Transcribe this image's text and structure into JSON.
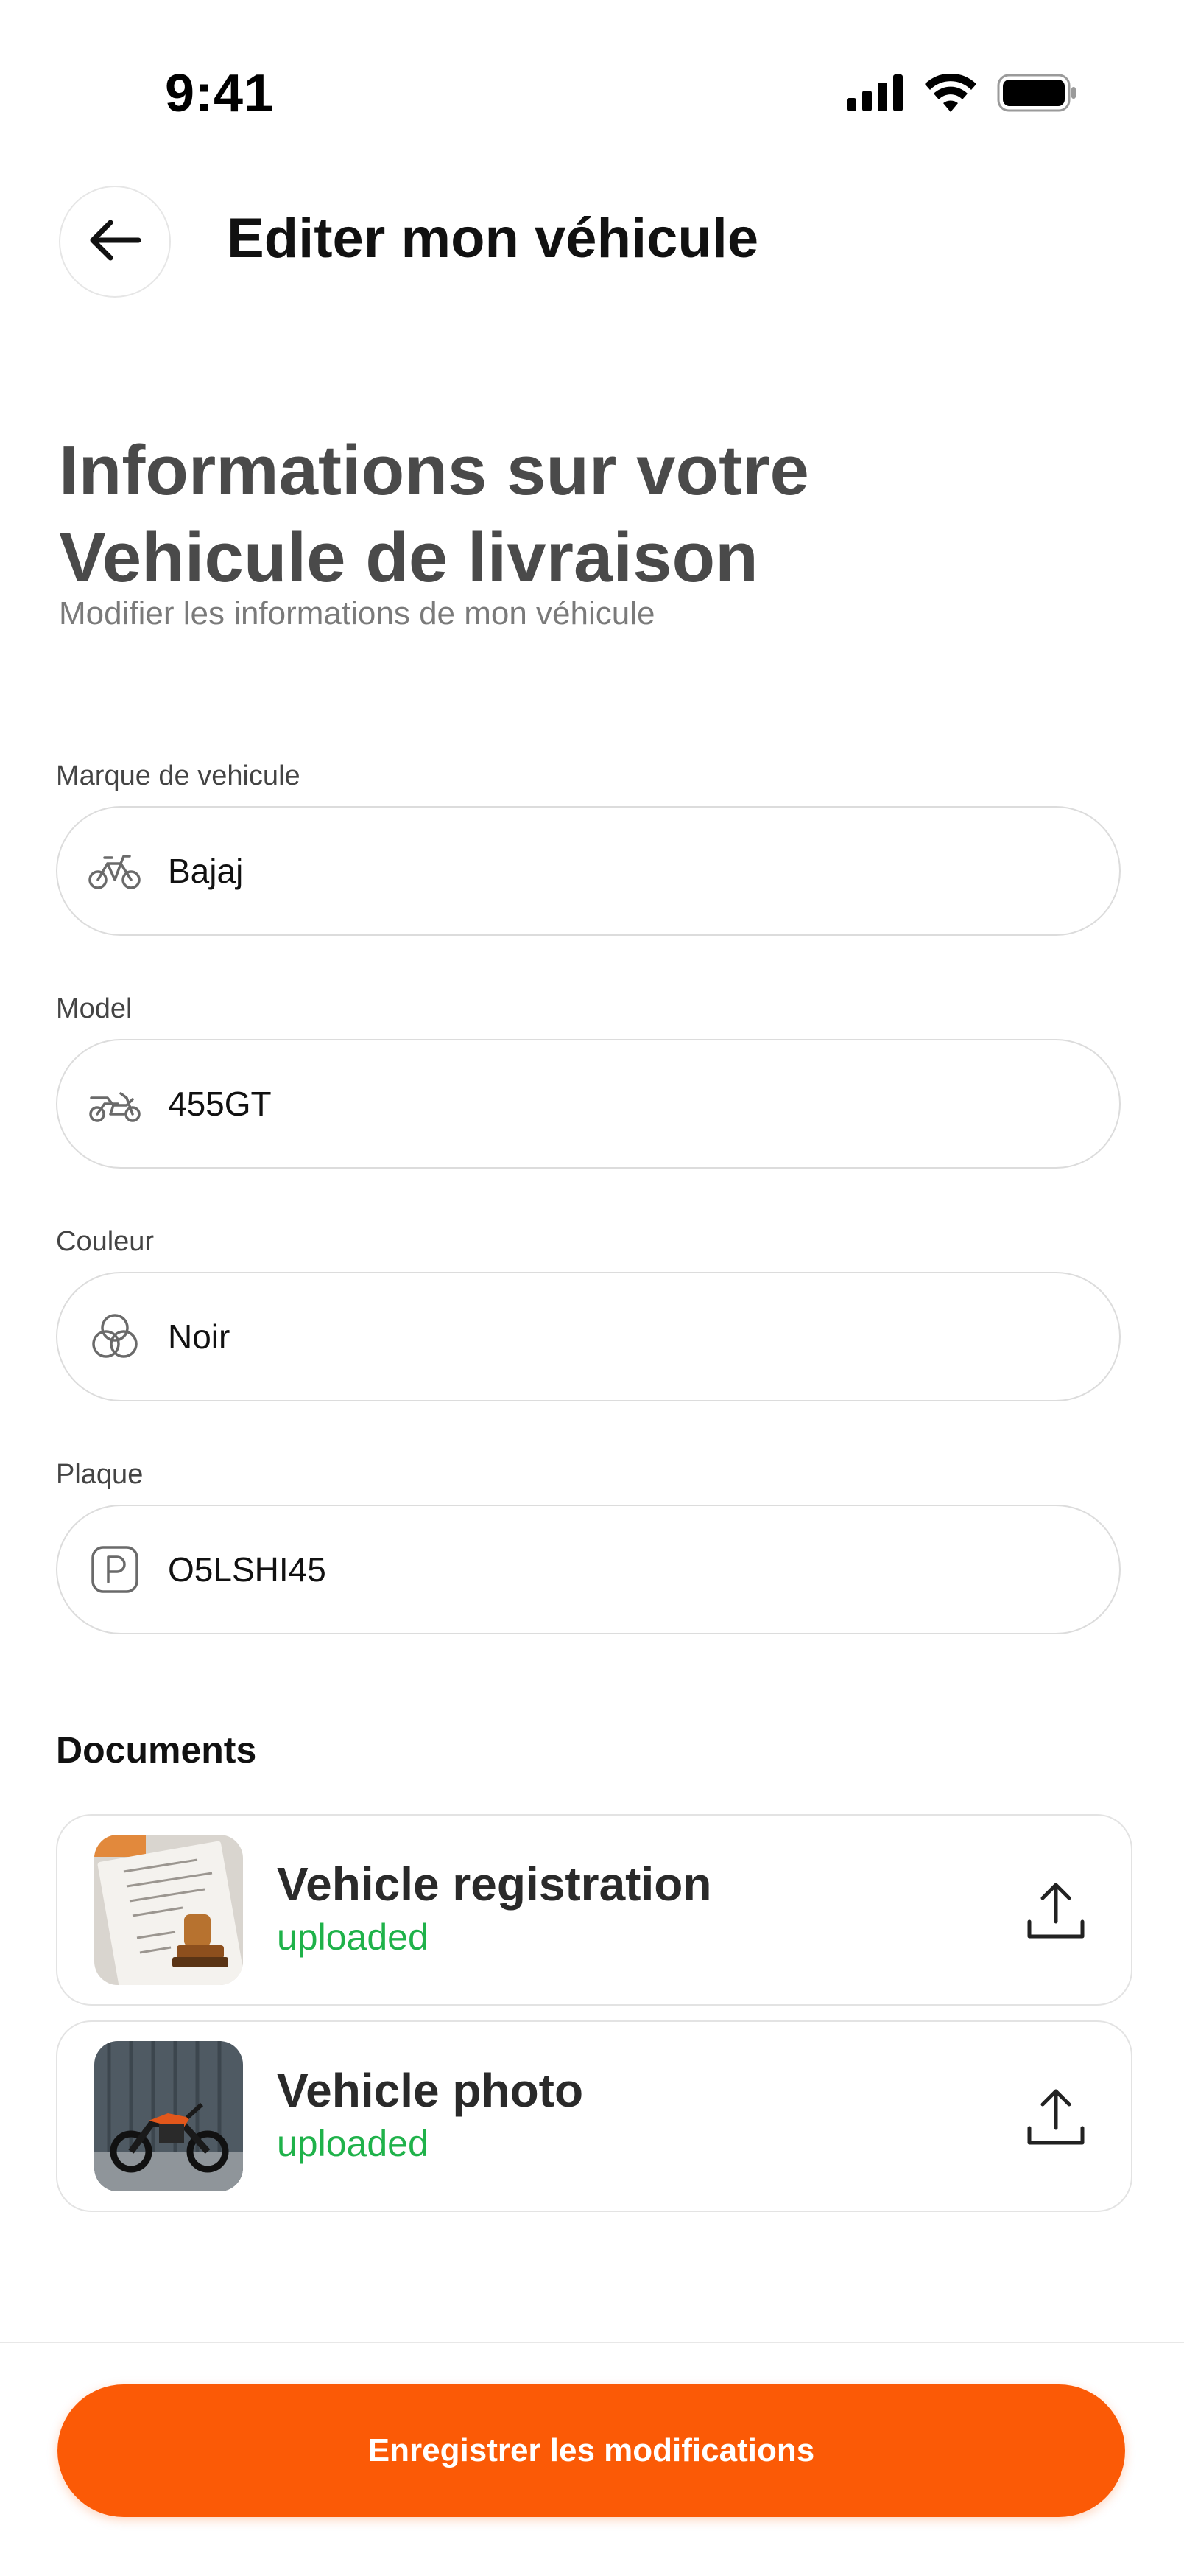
{
  "status_bar": {
    "time": "9:41"
  },
  "header": {
    "title": "Editer mon véhicule"
  },
  "intro": {
    "title_line1": "Informations sur votre",
    "title_line2": "Vehicule de livraison",
    "subtitle": "Modifier les informations de mon véhicule"
  },
  "fields": [
    {
      "label": "Marque de vehicule",
      "value": "Bajaj",
      "icon": "bicycle-icon"
    },
    {
      "label": "Model",
      "value": "455GT",
      "icon": "motorcycle-icon"
    },
    {
      "label": "Couleur",
      "value": "Noir",
      "icon": "color-circles-icon"
    },
    {
      "label": "Plaque",
      "value": "O5LSHI45",
      "icon": "parking-plate-icon"
    }
  ],
  "documents": {
    "title": "Documents",
    "items": [
      {
        "name": "Vehicle registration",
        "status": "uploaded",
        "thumb_icon": "document-stamp-icon"
      },
      {
        "name": "Vehicle photo",
        "status": "uploaded",
        "thumb_icon": "motorcycle-photo-icon"
      }
    ]
  },
  "footer": {
    "save_label": "Enregistrer les modifications"
  },
  "colors": {
    "accent": "#fb5a06",
    "success": "#1fb24a",
    "heading": "#4a4a4a"
  }
}
